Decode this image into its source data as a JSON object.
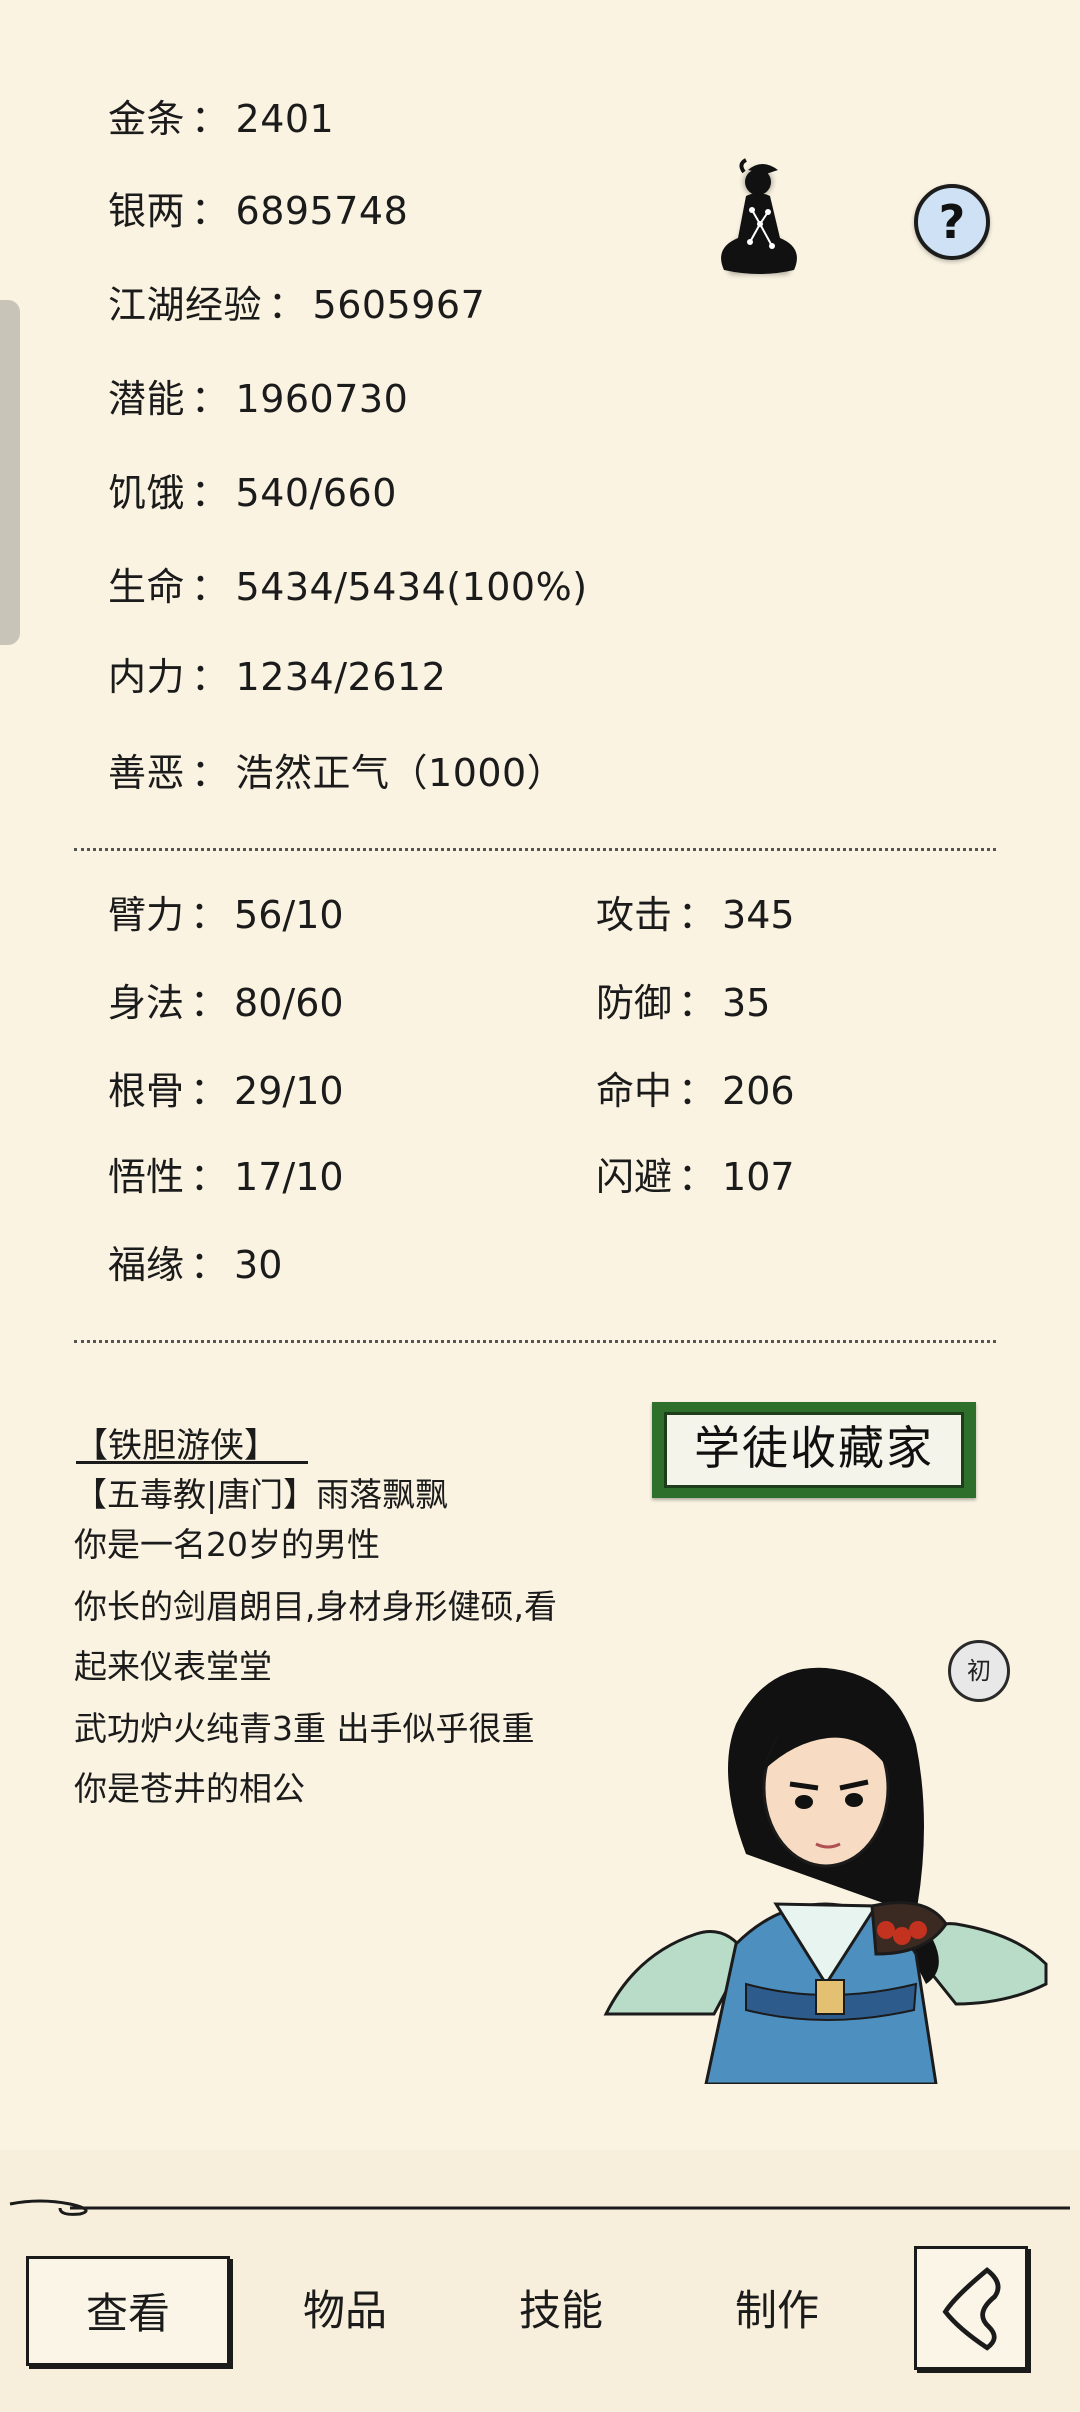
{
  "resources": {
    "gold": {
      "label": "金条",
      "value": "2401"
    },
    "silver": {
      "label": "银两",
      "value": "6895748"
    },
    "experience": {
      "label": "江湖经验",
      "value": "5605967"
    },
    "potential": {
      "label": "潜能",
      "value": "1960730"
    },
    "hunger": {
      "label": "饥饿",
      "value": "540/660"
    },
    "life": {
      "label": "生命",
      "value": "5434/5434(100%)"
    },
    "inner_power": {
      "label": "内力",
      "value": "1234/2612"
    },
    "morality": {
      "label": "善恶",
      "value": "浩然正气（1000）"
    }
  },
  "separator": "：",
  "attributes": {
    "strength": {
      "label": "臂力",
      "value": "56/10"
    },
    "agility": {
      "label": "身法",
      "value": "80/60"
    },
    "constitution": {
      "label": "根骨",
      "value": "29/10"
    },
    "comprehension": {
      "label": "悟性",
      "value": "17/10"
    },
    "luck": {
      "label": "福缘",
      "value": "30"
    },
    "attack": {
      "label": "攻击",
      "value": "345"
    },
    "defense": {
      "label": "防御",
      "value": "35"
    },
    "accuracy": {
      "label": "命中",
      "value": "206"
    },
    "dodge": {
      "label": "闪避",
      "value": "107"
    }
  },
  "profile": {
    "title": "【铁胆游侠】",
    "sect_name": "【五毒教|唐门】雨落飘飘",
    "line1": "你是一名20岁的男性",
    "line2": "你长的剑眉朗目,身材身形健硕,看",
    "line3": "起来仪表堂堂",
    "line4": "武功炉火纯青3重 出手似乎很重",
    "line5": "你是苍井的相公",
    "badge": "学徒收藏家",
    "seal": "初"
  },
  "help": {
    "label": "?"
  },
  "tabs": {
    "view": "查看",
    "items": "物品",
    "skills": "技能",
    "craft": "制作"
  },
  "icons": {
    "help": "help-icon",
    "meditate": "meditation-icon",
    "back": "back-icon"
  }
}
